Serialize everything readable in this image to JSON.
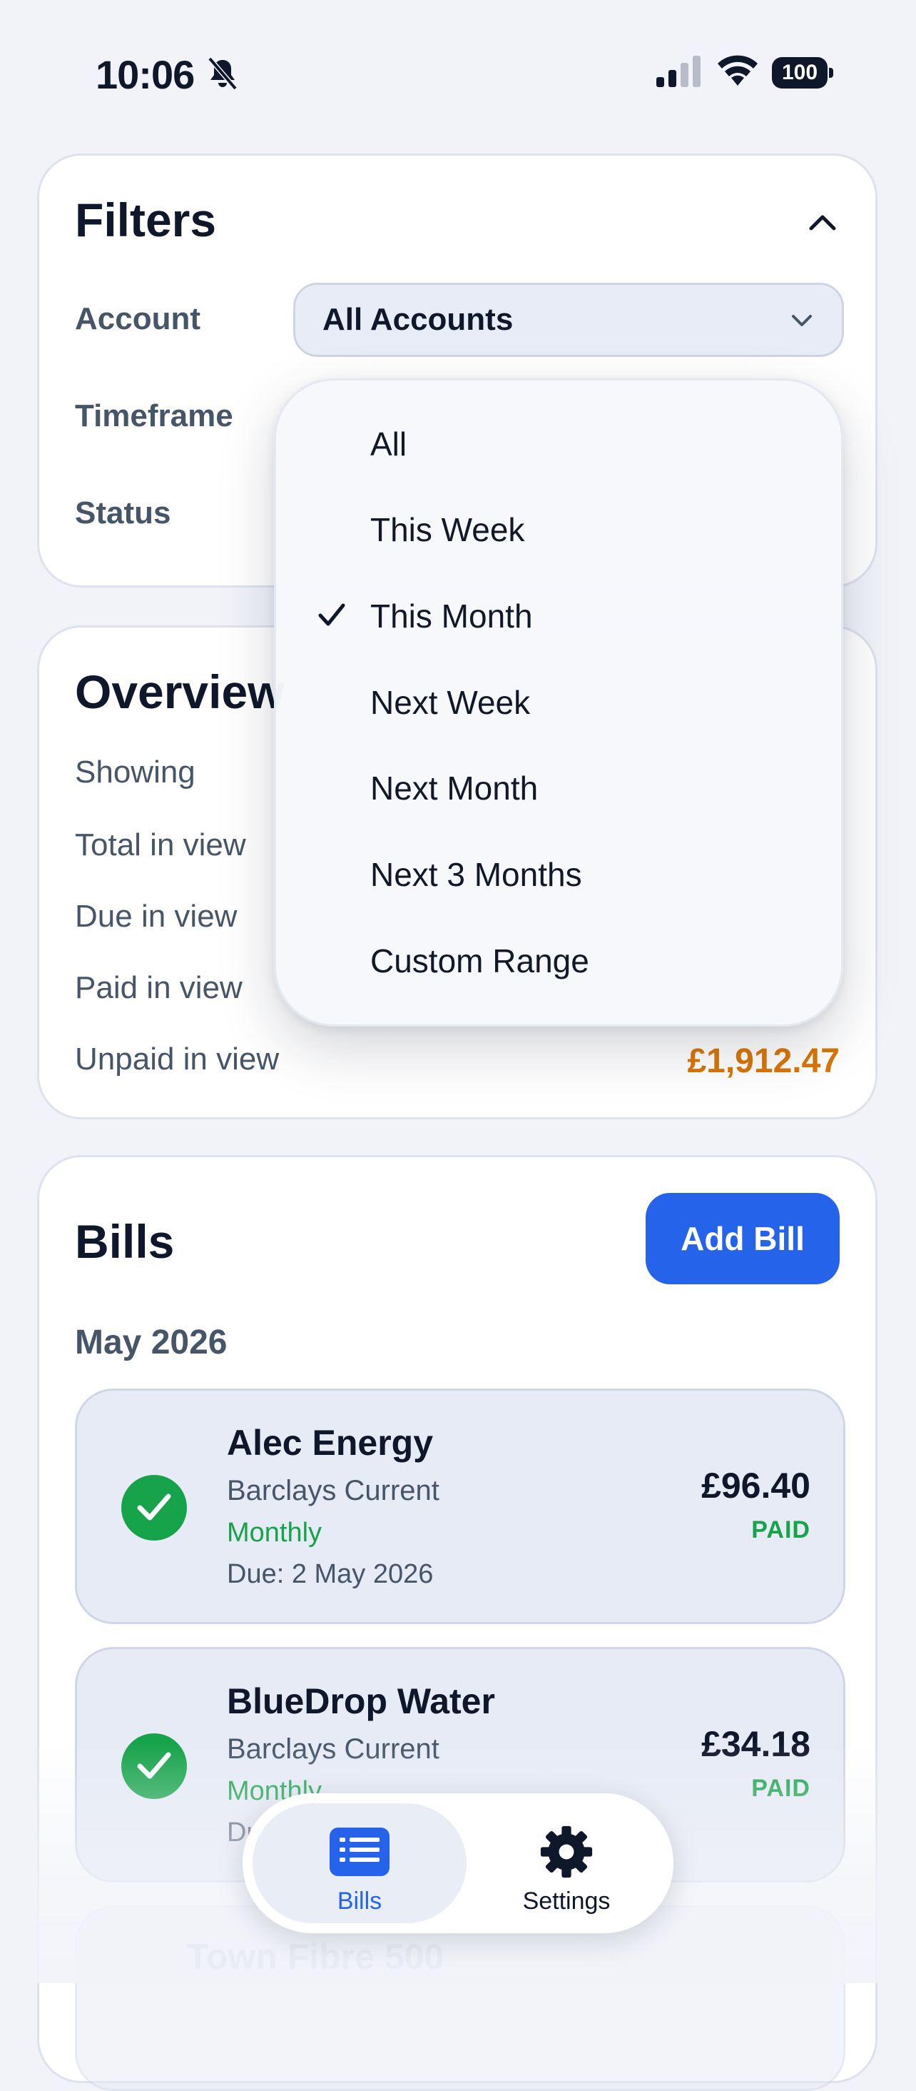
{
  "status_bar": {
    "time": "10:06",
    "battery": "100",
    "icons": [
      "bell-slash-icon",
      "signal-icon",
      "wifi-icon",
      "battery-icon"
    ]
  },
  "filters": {
    "title": "Filters",
    "account_label": "Account",
    "account_value": "All Accounts",
    "timeframe_label": "Timeframe",
    "status_label": "Status"
  },
  "timeframe_menu": {
    "selected": "This Month",
    "options": [
      "All",
      "This Week",
      "This Month",
      "Next Week",
      "Next Month",
      "Next 3 Months",
      "Custom Range"
    ]
  },
  "overview": {
    "title": "Overview",
    "rows": [
      {
        "label": "Showing"
      },
      {
        "label": "Total in view"
      },
      {
        "label": "Due in view"
      },
      {
        "label": "Paid in view"
      },
      {
        "label": "Unpaid in view",
        "value": "£1,912.47"
      }
    ]
  },
  "bills": {
    "title": "Bills",
    "add_button": "Add Bill",
    "month": "May 2026",
    "items": [
      {
        "name": "Alec Energy",
        "account": "Barclays Current",
        "frequency": "Monthly",
        "due": "Due: 2 May 2026",
        "amount": "£96.40",
        "status": "PAID"
      },
      {
        "name": "BlueDrop Water",
        "account": "Barclays Current",
        "frequency": "Monthly",
        "due": "Du",
        "amount": "£34.18",
        "status": "PAID"
      },
      {
        "name": "Town Fibre 500"
      }
    ]
  },
  "tab_bar": {
    "bills_label": "Bills",
    "settings_label": "Settings"
  },
  "colors": {
    "accent": "#2563eb",
    "paid": "#16a34a",
    "unpaid": "#d97706",
    "text": "#0f172a",
    "muted": "#475569",
    "background": "#f1f3f9"
  }
}
